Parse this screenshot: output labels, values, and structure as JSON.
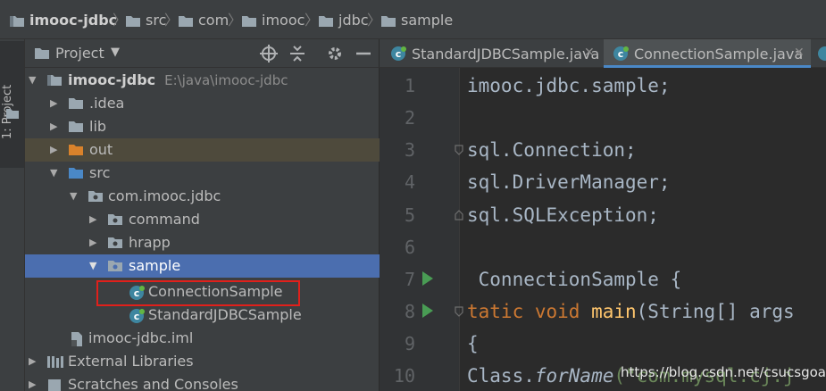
{
  "breadcrumb": [
    {
      "label": "imooc-jdbc",
      "icon": "project-folder-icon"
    },
    {
      "label": "src",
      "icon": "folder-icon"
    },
    {
      "label": "com",
      "icon": "folder-icon"
    },
    {
      "label": "imooc",
      "icon": "folder-icon"
    },
    {
      "label": "jdbc",
      "icon": "folder-icon"
    },
    {
      "label": "sample",
      "icon": "folder-icon"
    }
  ],
  "stripe": {
    "label": "1: Project"
  },
  "project_panel": {
    "title": "Project",
    "header_icons": [
      "locate-icon",
      "collapse-all-icon",
      "gear-icon",
      "hide-icon"
    ],
    "tree": [
      {
        "label": "imooc-jdbc",
        "path": "E:\\java\\imooc-jdbc",
        "icon": "project-folder-icon",
        "expanded": true
      },
      {
        "label": ".idea",
        "icon": "folder-icon",
        "expanded": false
      },
      {
        "label": "lib",
        "icon": "folder-icon",
        "expanded": false
      },
      {
        "label": "out",
        "icon": "excluded-folder-icon",
        "expanded": false
      },
      {
        "label": "src",
        "icon": "source-folder-icon",
        "expanded": true
      },
      {
        "label": "com.imooc.jdbc",
        "icon": "package-icon",
        "expanded": true
      },
      {
        "label": "command",
        "icon": "package-icon",
        "expanded": false
      },
      {
        "label": "hrapp",
        "icon": "package-icon",
        "expanded": false
      },
      {
        "label": "sample",
        "icon": "package-icon",
        "expanded": true,
        "selected": true
      },
      {
        "label": "ConnectionSample",
        "icon": "java-class-icon"
      },
      {
        "label": "StandardJDBCSample",
        "icon": "java-class-icon"
      },
      {
        "label": "imooc-jdbc.iml",
        "icon": "iml-file-icon"
      },
      {
        "label": "External Libraries",
        "icon": "libraries-icon",
        "expanded": false
      },
      {
        "label": "Scratches and Consoles",
        "icon": "scratches-icon",
        "expanded": false
      }
    ]
  },
  "editor": {
    "tabs": [
      {
        "label": "StandardJDBCSample.java",
        "active": false
      },
      {
        "label": "ConnectionSample.java",
        "active": true
      }
    ],
    "line_numbers": [
      "1",
      "2",
      "3",
      "4",
      "5",
      "6",
      "7",
      "8",
      "9",
      "10"
    ],
    "code_lines": [
      {
        "parts": [
          {
            "t": "imooc.jdbc.sample;",
            "c": ""
          }
        ]
      },
      {
        "parts": []
      },
      {
        "parts": [
          {
            "t": "sql.Connection;",
            "c": ""
          }
        ]
      },
      {
        "parts": [
          {
            "t": "sql.DriverManager;",
            "c": ""
          }
        ]
      },
      {
        "parts": [
          {
            "t": "sql.SQLException;",
            "c": ""
          }
        ]
      },
      {
        "parts": []
      },
      {
        "parts": [
          {
            "t": " ConnectionSample {",
            "c": ""
          }
        ]
      },
      {
        "parts": [
          {
            "t": "tatic ",
            "c": "kw"
          },
          {
            "t": "void ",
            "c": "kw"
          },
          {
            "t": "main",
            "c": "fn"
          },
          {
            "t": "(String[] args",
            "c": ""
          }
        ]
      },
      {
        "parts": [
          {
            "t": "{",
            "c": ""
          }
        ]
      },
      {
        "parts": [
          {
            "t": "Class.",
            "c": ""
          },
          {
            "t": "forName",
            "c": "it"
          },
          {
            "t": "(\"com.mysql.cj.j",
            "c": "str"
          }
        ]
      }
    ],
    "watermark": "https://blog.csdn.net/csucsgoat"
  },
  "colors": {
    "selection": "#4b6eaf",
    "highlight_box": "#e0201b",
    "run_arrow": "#499c54"
  }
}
